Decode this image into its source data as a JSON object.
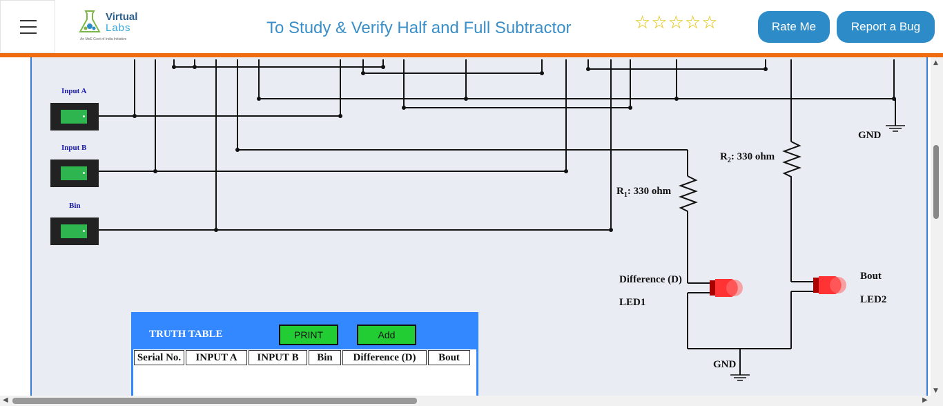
{
  "header": {
    "menu_icon": "hamburger-menu-icon",
    "logo": {
      "line1": "Virtual",
      "line2": "Labs",
      "tagline": "An MoE Govt of India Initiative"
    },
    "title": "To Study & Verify Half and Full Subtractor",
    "rating": {
      "stars": "☆☆☆☆☆",
      "value": 0,
      "max": 5
    },
    "rate_button": "Rate Me",
    "bug_button": "Report a Bug",
    "accent_color": "#f06a0f",
    "button_color": "#2d8bc7"
  },
  "circuit": {
    "inputs": [
      {
        "label": "Input A"
      },
      {
        "label": "Input B"
      },
      {
        "label": "Bin"
      }
    ],
    "r1_label": "R",
    "r1_sub": "1",
    "r1_value": ": 330 ohm",
    "r2_label": "R",
    "r2_sub": "2",
    "r2_value": ": 330 ohm",
    "gnd_top": "GND",
    "gnd_bottom": "GND",
    "led1_name": "Difference (D)",
    "led1_label": "LED1",
    "led2_name": "Bout",
    "led2_label": "LED2"
  },
  "truth_table": {
    "title": "TRUTH TABLE",
    "print_button": "PRINT",
    "add_button": "Add",
    "columns": [
      "Serial No.",
      "INPUT A",
      "INPUT B",
      "Bin",
      "Difference (D)",
      "Bout"
    ],
    "rows": []
  }
}
